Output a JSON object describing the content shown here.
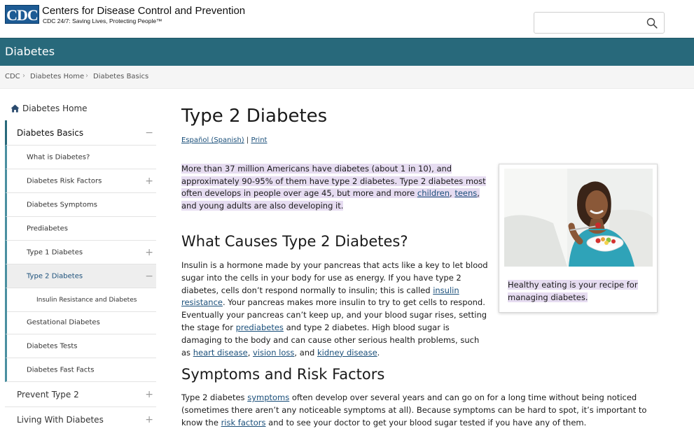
{
  "header": {
    "logo_text": "CDC",
    "org_name": "Centers for Disease Control and Prevention",
    "tagline": "CDC 24/7: Saving Lives, Protecting People™",
    "search": {
      "value": "",
      "placeholder": ""
    }
  },
  "site": {
    "title": "Diabetes"
  },
  "breadcrumb": [
    "CDC",
    "Diabetes Home",
    "Diabetes Basics"
  ],
  "sidebar": {
    "home_label": "Diabetes Home",
    "section": {
      "label": "Diabetes Basics",
      "toggle": "−"
    },
    "items": [
      {
        "label": "What is Diabetes?",
        "toggle": ""
      },
      {
        "label": "Diabetes Risk Factors",
        "toggle": "+"
      },
      {
        "label": "Diabetes Symptoms",
        "toggle": ""
      },
      {
        "label": "Prediabetes",
        "toggle": ""
      },
      {
        "label": "Type 1 Diabetes",
        "toggle": "+"
      },
      {
        "label": "Type 2 Diabetes",
        "toggle": "−"
      },
      {
        "label": "Insulin Resistance and Diabetes",
        "toggle": ""
      },
      {
        "label": "Gestational Diabetes",
        "toggle": ""
      },
      {
        "label": "Diabetes Tests",
        "toggle": ""
      },
      {
        "label": "Diabetes Fast Facts",
        "toggle": ""
      }
    ],
    "top_items": [
      {
        "label": "Prevent Type 2",
        "toggle": "+"
      },
      {
        "label": "Living With Diabetes",
        "toggle": "+"
      }
    ]
  },
  "main": {
    "title": "Type 2 Diabetes",
    "lang_link": "Español (Spanish)",
    "lang_sep": "|",
    "print_link": "Print",
    "lead": {
      "text1": "More than 37 million Americans have diabetes (about 1 in 10), and approximately 90-95% of them have type 2 diabetes. Type 2 diabetes most often develops in people over age 45, but more and more ",
      "link1": "children",
      "comma": ", ",
      "link2": "teens",
      "text2": ", and young adults are also developing it."
    },
    "causes": {
      "heading": "What Causes Type 2 Diabetes?",
      "t1": "Insulin is a hormone made by your pancreas that acts like a key to let blood sugar into the cells in your body for use as energy. If you have type 2 diabetes, cells don’t respond normally to insulin; this is called ",
      "l1": "insulin resistance",
      "t2": ". Your pancreas makes more insulin to try to get cells to respond. Eventually your pancreas can’t keep up, and your blood sugar rises, setting the stage for ",
      "l2": "prediabetes",
      "t3": " and type 2 diabetes. High blood sugar is damaging to the body and can cause other serious health problems, such as ",
      "l3": "heart disease",
      "t4": ",  ",
      "l4": "vision loss",
      "t5": ", and ",
      "l5": "kidney disease",
      "t6": "."
    },
    "symptoms": {
      "heading": "Symptoms and Risk Factors",
      "t1": "Type 2 diabetes ",
      "l1": "symptoms",
      "t2": " often develop over several years and can go on for a long time without being noticed (sometimes there aren’t any noticeable symptoms at all). Because symptoms can be hard to spot, it’s important to know the ",
      "l2": "risk factors",
      "t3": " and to see your doctor to get your blood sugar tested if you have any of them."
    },
    "figure": {
      "caption": "Healthy eating is your recipe for managing diabetes."
    }
  },
  "colors": {
    "site_bar": "#28697b",
    "link": "#1a4f7a",
    "highlight": "#e6dcf1",
    "logo": "#1d5b94"
  }
}
